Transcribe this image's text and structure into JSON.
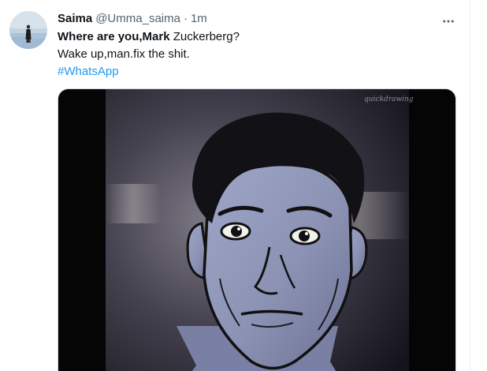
{
  "tweet": {
    "author": {
      "display_name": "Saima",
      "handle": "@Umma_saima"
    },
    "separator": "·",
    "timestamp": "1m",
    "text": {
      "line1_bold": "Where are you,Mark",
      "line1_rest": " Zuckerberg?",
      "line2": "Wake up,man.fix the shit.",
      "hashtag": "#WhatsApp"
    },
    "media": {
      "watermark": "quickdrawing"
    }
  },
  "icons": {
    "more": "more-horizontal-icon",
    "avatar": "user-avatar"
  },
  "colors": {
    "primary_text": "#0f1419",
    "secondary_text": "#536471",
    "link": "#1d9bf0",
    "border": "#cfd9de"
  }
}
